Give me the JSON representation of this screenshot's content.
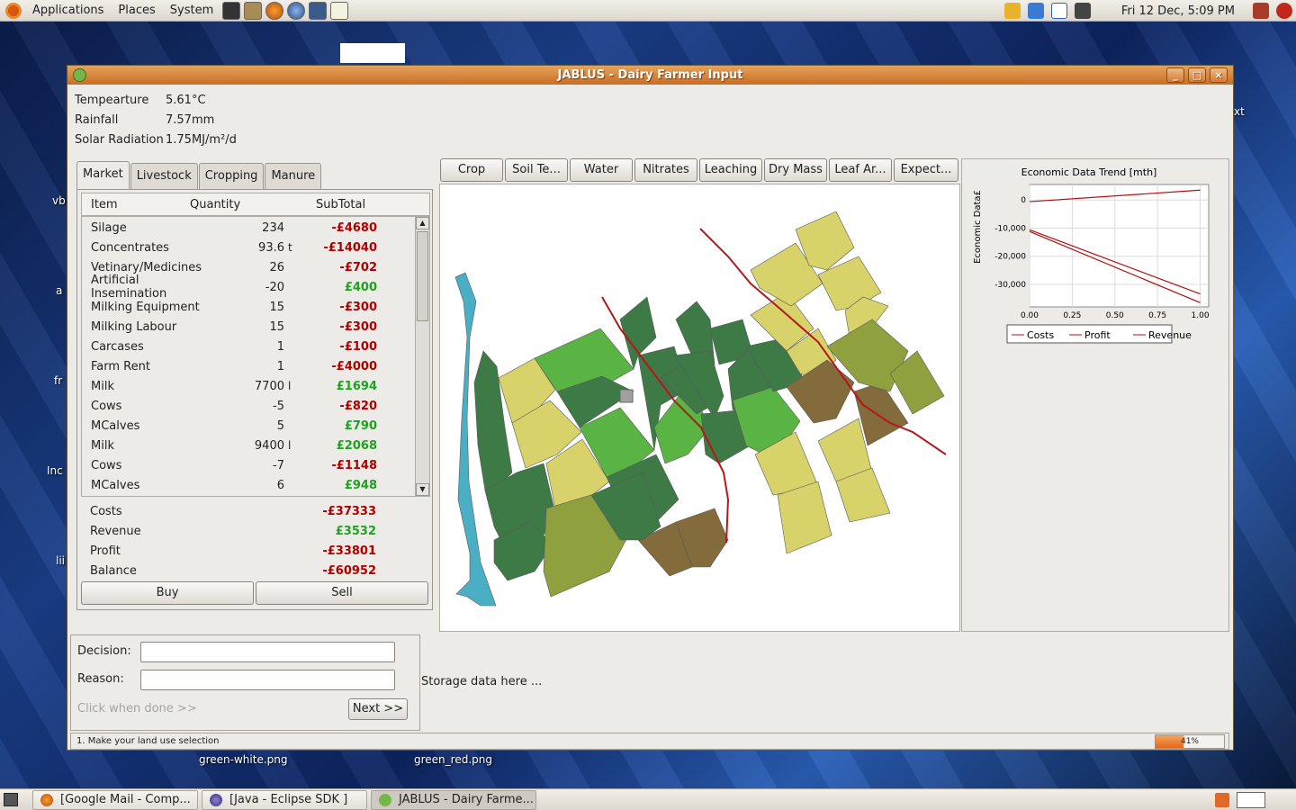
{
  "top_panel": {
    "menus": [
      "Applications",
      "Places",
      "System"
    ],
    "clock": "Fri 12 Dec,  5:09 PM"
  },
  "desktop": {
    "files": [
      "green-white.png",
      "green_red.png"
    ],
    "edge_labels": [
      "vb",
      "a",
      "fr",
      "Inc",
      "lii"
    ],
    "right_label": "xt"
  },
  "window": {
    "title": "JABLUS - Dairy Farmer Input",
    "weather": [
      {
        "label": "Tempearture",
        "value": "5.61°C"
      },
      {
        "label": "Rainfall",
        "value": "7.57mm"
      },
      {
        "label": "Solar Radiation",
        "value": "1.75MJ/m²/d"
      }
    ],
    "tabs": [
      "Market",
      "Livestock",
      "Cropping",
      "Manure"
    ],
    "table_headers": {
      "item": "Item",
      "quantity": "Quantity",
      "subtotal": "SubTotal"
    },
    "rows": [
      {
        "item": "Silage",
        "qty": "234",
        "unit": "",
        "sub": "-£4680",
        "sign": "neg"
      },
      {
        "item": "Concentrates",
        "qty": "93.6",
        "unit": "t",
        "sub": "-£14040",
        "sign": "neg"
      },
      {
        "item": "Vetinary/Medicines",
        "qty": "26",
        "unit": "",
        "sub": "-£702",
        "sign": "neg"
      },
      {
        "item": "Artificial Insemination",
        "qty": "-20",
        "unit": "",
        "sub": "£400",
        "sign": "pos"
      },
      {
        "item": "Milking Equipment",
        "qty": "15",
        "unit": "",
        "sub": "-£300",
        "sign": "neg"
      },
      {
        "item": "Milking Labour",
        "qty": "15",
        "unit": "",
        "sub": "-£300",
        "sign": "neg"
      },
      {
        "item": "Carcases",
        "qty": "1",
        "unit": "",
        "sub": "-£100",
        "sign": "neg"
      },
      {
        "item": "Farm Rent",
        "qty": "1",
        "unit": "",
        "sub": "-£4000",
        "sign": "neg"
      },
      {
        "item": "Milk",
        "qty": "7700",
        "unit": "l",
        "sub": "£1694",
        "sign": "pos"
      },
      {
        "item": "Cows",
        "qty": "-5",
        "unit": "",
        "sub": "-£820",
        "sign": "neg"
      },
      {
        "item": "MCalves",
        "qty": "5",
        "unit": "",
        "sub": "£790",
        "sign": "pos"
      },
      {
        "item": "Milk",
        "qty": "9400",
        "unit": "l",
        "sub": "£2068",
        "sign": "pos"
      },
      {
        "item": "Cows",
        "qty": "-7",
        "unit": "",
        "sub": "-£1148",
        "sign": "neg"
      },
      {
        "item": "MCalves",
        "qty": "6",
        "unit": "",
        "sub": "£948",
        "sign": "pos"
      }
    ],
    "totals": [
      {
        "label": "Costs",
        "value": "-£37333",
        "sign": "neg"
      },
      {
        "label": "Revenue",
        "value": "£3532",
        "sign": "pos"
      },
      {
        "label": "Profit",
        "value": "-£33801",
        "sign": "neg"
      },
      {
        "label": "Balance",
        "value": "-£60952",
        "sign": "neg"
      }
    ],
    "buy_label": "Buy",
    "sell_label": "Sell",
    "layer_buttons": [
      "Crop",
      "Soil Te...",
      "Water",
      "Nitrates",
      "Leaching",
      "Dry Mass",
      "Leaf Ar...",
      "Expect..."
    ],
    "decision_label": "Decision:",
    "reason_label": "Reason:",
    "decision_value": "",
    "reason_value": "",
    "click_hint": "Click when done >>",
    "next_label": "Next >>",
    "storage_text": "Storage data here ...",
    "status_text": "1. Make your land use selection",
    "progress_text": "41%",
    "progress_value": 0.41
  },
  "chart_data": {
    "type": "line",
    "title": "Economic Data Trend [mth]",
    "xlabel": "",
    "ylabel": "Economic Data£",
    "x_ticks": [
      "0.00",
      "0.25",
      "0.50",
      "0.75",
      "1.00"
    ],
    "y_ticks": [
      "0",
      "-10,000",
      "-20,000",
      "-30,000"
    ],
    "xlim": [
      0,
      1.05
    ],
    "ylim": [
      -38000,
      5500
    ],
    "legend": "bottom",
    "series": [
      {
        "name": "Costs",
        "color": "#b01010",
        "x": [
          0,
          1
        ],
        "y": [
          -10600,
          -33400
        ]
      },
      {
        "name": "Profit",
        "color": "#b01010",
        "x": [
          0,
          1
        ],
        "y": [
          -11200,
          -36500
        ]
      },
      {
        "name": "Revenue",
        "color": "#b01010",
        "x": [
          0,
          1
        ],
        "y": [
          -600,
          3500
        ]
      }
    ]
  },
  "map_colors": {
    "water": "#4aaec4",
    "dark_green": "#3d7a45",
    "bright_green": "#5ab444",
    "yellow": "#d8d26a",
    "olive": "#8fa13e",
    "brown": "#836b3c",
    "road": "#b51818"
  },
  "taskbar": [
    {
      "label": "[Google Mail - Comp...",
      "icon": "firefox-icon"
    },
    {
      "label": "[Java - Eclipse SDK ]",
      "icon": "eclipse-icon"
    },
    {
      "label": "JABLUS - Dairy Farme...",
      "icon": "jablus-icon"
    }
  ]
}
